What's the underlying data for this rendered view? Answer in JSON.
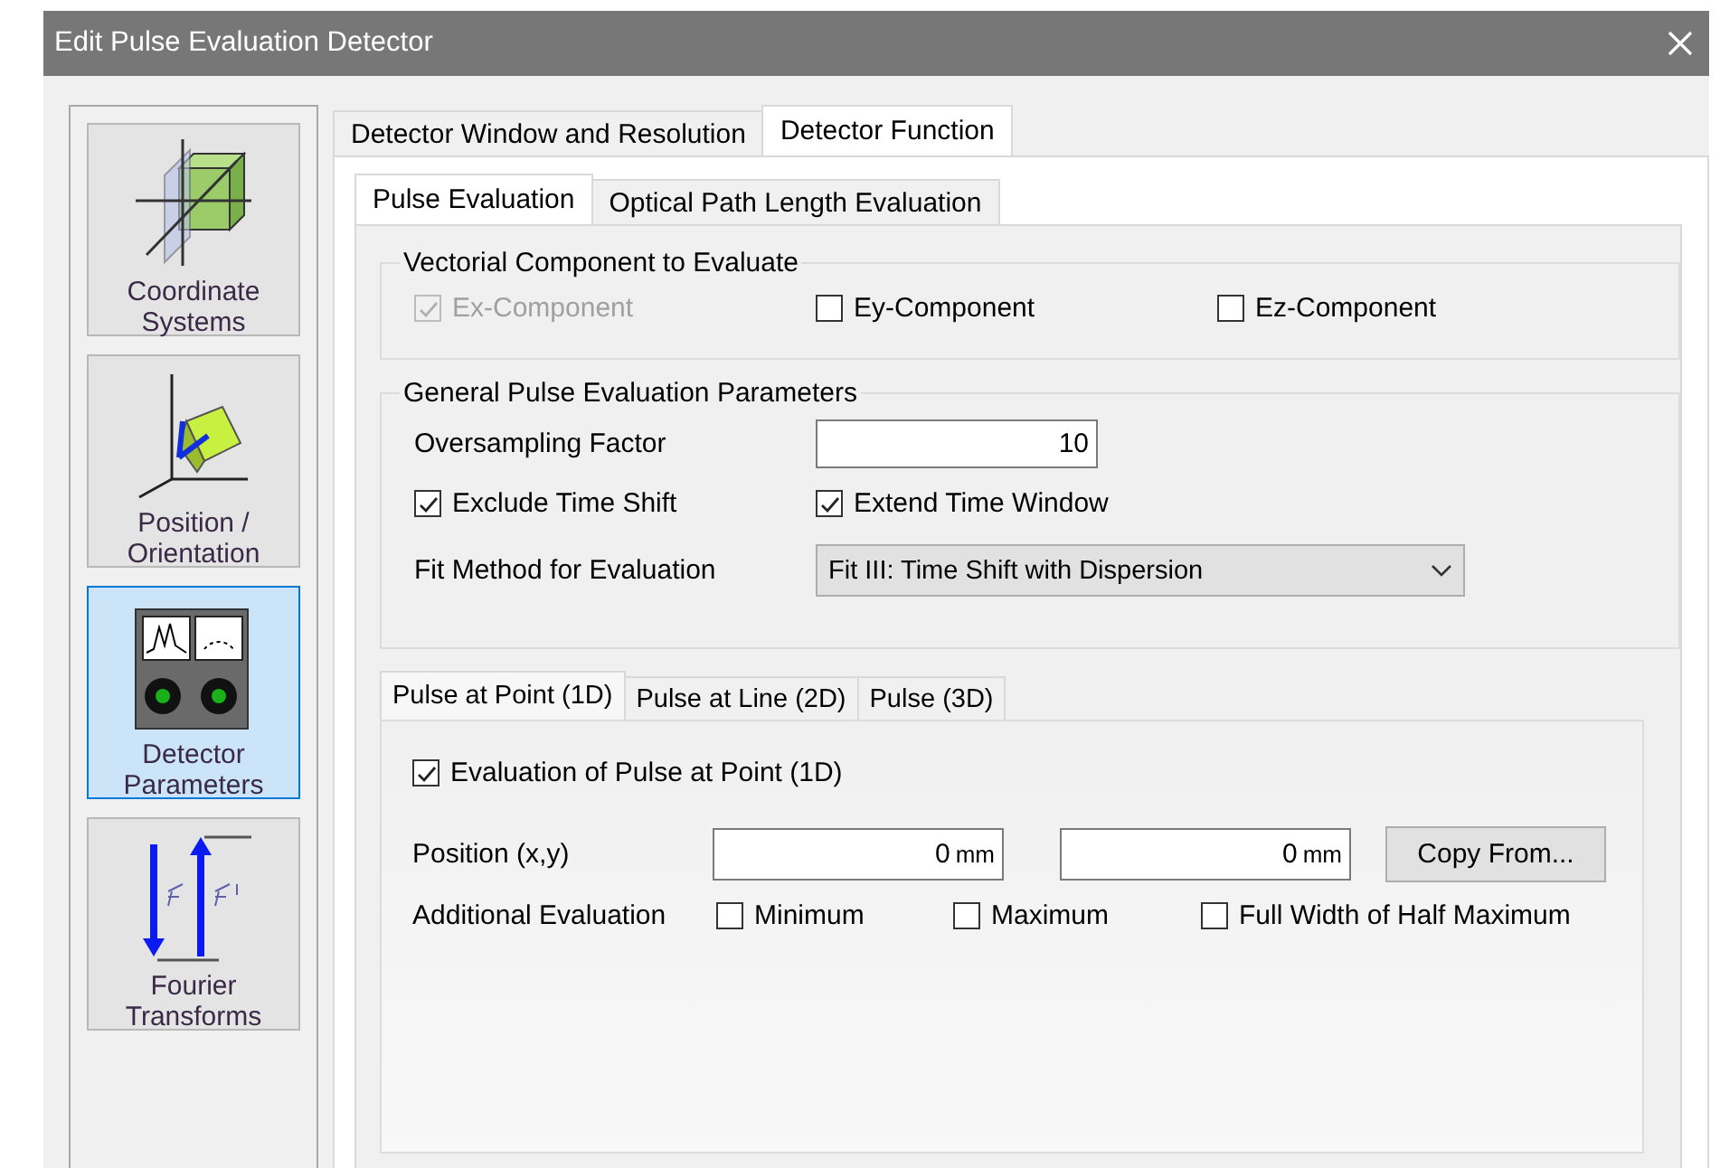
{
  "window": {
    "title": "Edit Pulse Evaluation Detector"
  },
  "sidebar": {
    "items": [
      {
        "label": "Coordinate Systems",
        "kind": "coordinates",
        "selected": false
      },
      {
        "label": "Position / Orientation",
        "kind": "position",
        "selected": false
      },
      {
        "label": "Detector Parameters",
        "kind": "detector",
        "selected": true
      },
      {
        "label": "Fourier Transforms",
        "kind": "fourier",
        "selected": false
      }
    ]
  },
  "tabs": [
    {
      "label": "Detector Window and Resolution",
      "selected": false
    },
    {
      "label": "Detector Function",
      "selected": true
    }
  ],
  "subtabs": [
    {
      "label": "Pulse Evaluation",
      "selected": true
    },
    {
      "label": "Optical Path Length Evaluation",
      "selected": false
    }
  ],
  "vector_group": {
    "title": "Vectorial Component to Evaluate",
    "checkboxes": [
      {
        "label": "Ex-Component",
        "checked": true,
        "disabled": true
      },
      {
        "label": "Ey-Component",
        "checked": false,
        "disabled": false
      },
      {
        "label": "Ez-Component",
        "checked": false,
        "disabled": false
      }
    ]
  },
  "params_group": {
    "title": "General Pulse Evaluation Parameters",
    "oversampling": {
      "label": "Oversampling Factor",
      "value": "10"
    },
    "checkboxes": [
      {
        "label": "Exclude Time Shift",
        "checked": true
      },
      {
        "label": "Extend Time Window",
        "checked": true
      }
    ],
    "fit_method": {
      "label": "Fit Method for Evaluation",
      "value": "Fit III: Time Shift with Dispersion"
    }
  },
  "point_tabs": [
    {
      "label": "Pulse at Point (1D)",
      "selected": true
    },
    {
      "label": "Pulse at Line (2D)",
      "selected": false
    },
    {
      "label": "Pulse (3D)",
      "selected": false
    }
  ],
  "point_panel": {
    "checkbox": {
      "label": "Evaluation of Pulse at Point (1D)",
      "checked": true
    },
    "position": {
      "label": "Position (x,y)",
      "fields": [
        {
          "value": "0",
          "unit": "mm"
        },
        {
          "value": "0",
          "unit": "mm"
        }
      ]
    },
    "copy_button": "Copy From...",
    "additional": {
      "label": "Additional Evaluation",
      "checkboxes": [
        {
          "label": "Minimum",
          "checked": false
        },
        {
          "label": "Maximum",
          "checked": false
        },
        {
          "label": "Full Width of Half Maximum",
          "checked": false
        }
      ]
    }
  }
}
